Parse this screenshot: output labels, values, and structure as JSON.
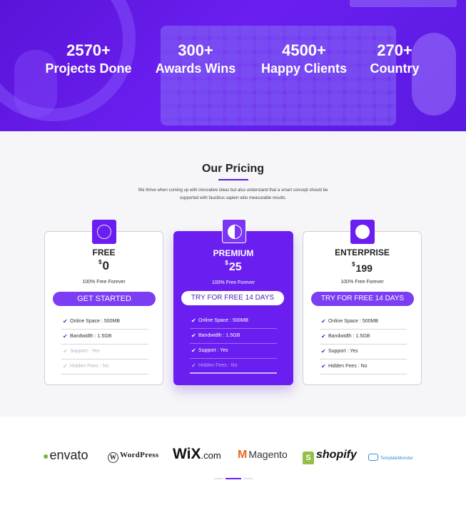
{
  "hero": {
    "stats": [
      {
        "number": "2570+",
        "label": "Projects Done"
      },
      {
        "number": "300+",
        "label": "Awards Wins"
      },
      {
        "number": "4500+",
        "label": "Happy Clients"
      },
      {
        "number": "270+",
        "label": "Country"
      }
    ]
  },
  "pricing": {
    "title": "Our Pricing",
    "description_line1": "We thrive when coming up with innovative ideas but also understand that a smart concept should be",
    "description_line2": "supported with faucibus sapien odio measurable results.",
    "plans": [
      {
        "name": "FREE",
        "currency": "$",
        "price": "0",
        "note": "100% Free Forever",
        "cta": "GET STARTED",
        "icon": "circle-outline-icon",
        "features": [
          {
            "text": "Online Space : 500MB",
            "enabled": true
          },
          {
            "text": "Bandwidth : 1.5GB",
            "enabled": true
          },
          {
            "text": "Support : Yes",
            "enabled": false
          },
          {
            "text": "Hidden Fees : No",
            "enabled": false
          }
        ]
      },
      {
        "name": "PREMIUM",
        "currency": "$",
        "price": "25",
        "note": "100% Free Forever",
        "cta": "TRY FOR FREE 14 DAYS",
        "icon": "half-circle-icon",
        "features": [
          {
            "text": "Online Space : 500MB",
            "enabled": true
          },
          {
            "text": "Bandwidth : 1.5GB",
            "enabled": true
          },
          {
            "text": "Support : Yes",
            "enabled": true
          },
          {
            "text": "Hidden Fees : No",
            "enabled": false
          }
        ]
      },
      {
        "name": "ENTERPRISE",
        "currency": "$",
        "price": "199",
        "note": "100% Free Forever",
        "cta": "TRY FOR FREE 14 DAYS",
        "icon": "filled-circle-icon",
        "features": [
          {
            "text": "Online Space : 500MB",
            "enabled": true
          },
          {
            "text": "Bandwidth : 1.5GB",
            "enabled": true
          },
          {
            "text": "Support : Yes",
            "enabled": true
          },
          {
            "text": "Hidden Fees : No",
            "enabled": true
          }
        ]
      }
    ],
    "tick_glyph": "✔"
  },
  "partners": {
    "envato": "envato",
    "wordpress_mark": "W",
    "wordpress": "WordPress",
    "wix": "WiX",
    "wix_suffix": ".com",
    "magento_mark": "M",
    "magento": "Magento",
    "shopify_mark": "S",
    "shopify": "shopify",
    "templatemonster": "TemplateMonster"
  },
  "colors": {
    "accent": "#6a1ff0",
    "hero_bg": "#5a14d8",
    "section_bg": "#f6f6f8"
  }
}
